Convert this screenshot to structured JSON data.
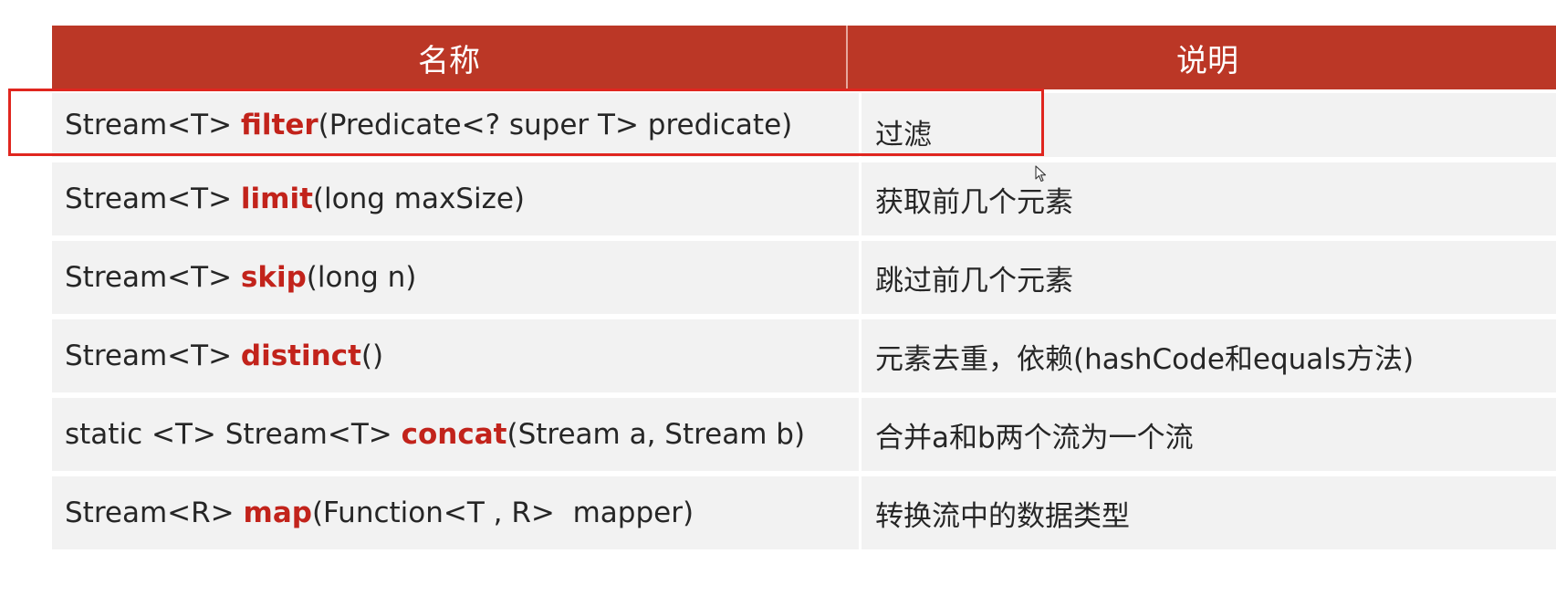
{
  "table": {
    "headers": {
      "name": "名称",
      "description": "说明"
    },
    "rows": [
      {
        "prefix": "Stream<T> ",
        "method": "filter",
        "suffix": "(Predicate<? super T> predicate)",
        "description": "过滤"
      },
      {
        "prefix": "Stream<T> ",
        "method": "limit",
        "suffix": "(long maxSize)",
        "description": "获取前几个元素"
      },
      {
        "prefix": "Stream<T> ",
        "method": "skip",
        "suffix": "(long n)",
        "description": "跳过前几个元素"
      },
      {
        "prefix": "Stream<T> ",
        "method": "distinct",
        "suffix": "()",
        "description": "元素去重，依赖(hashCode和equals方法)"
      },
      {
        "prefix": "static <T> Stream<T> ",
        "method": "concat",
        "suffix": "(Stream a, Stream b)",
        "description": "合并a和b两个流为一个流"
      },
      {
        "prefix": "Stream<R> ",
        "method": "map",
        "suffix": "(Function<T , R>  mapper)",
        "description": "转换流中的数据类型"
      }
    ]
  },
  "colors": {
    "header_bg": "#bb3726",
    "method_text": "#c2231b",
    "row_bg": "#f2f2f2",
    "highlight_border": "#e0261f"
  },
  "icons": {
    "cursor": "mouse-pointer-icon"
  }
}
